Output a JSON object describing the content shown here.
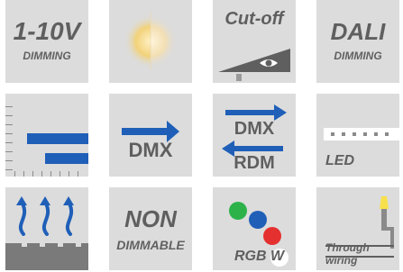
{
  "tiles": [
    {
      "id": "dimming-1-10v",
      "title": "1-10V",
      "subtitle": "DIMMING",
      "icon": "1-10v-dimming-icon"
    },
    {
      "id": "light-temperature",
      "icon": "color-temperature-icon"
    },
    {
      "id": "cut-off",
      "title": "Cut-off",
      "icon": "cut-off-eye-icon"
    },
    {
      "id": "dali-dimming",
      "title": "DALI",
      "subtitle": "DIMMING",
      "icon": "dali-dimming-icon"
    },
    {
      "id": "beam-lines",
      "icon": "linear-beam-icon"
    },
    {
      "id": "dmx",
      "label": "DMX",
      "icon": "dmx-arrow-icon"
    },
    {
      "id": "dmx-rdm",
      "label_top": "DMX",
      "label_bottom": "RDM",
      "icon": "dmx-rdm-arrows-icon"
    },
    {
      "id": "led-strip",
      "label": "LED",
      "icon": "led-strip-icon"
    },
    {
      "id": "heat-dissipation",
      "icon": "heat-dissipation-arrows-icon"
    },
    {
      "id": "non-dimmable",
      "title": "NON",
      "subtitle": "DIMMABLE",
      "icon": "non-dimmable-icon"
    },
    {
      "id": "rgbw",
      "label_rgb": "RGB",
      "label_w": "W",
      "icon": "rgbw-dots-icon"
    },
    {
      "id": "through-wiring",
      "label_top": "Through",
      "label_bottom": "wiring",
      "icon": "through-wiring-icon"
    }
  ],
  "colors": {
    "tile_bg": "#dcdcdc",
    "text": "#5f5f5f",
    "blue": "#1f5fb8",
    "red": "#e53030",
    "green": "#2db24a",
    "warm": "#f7d77b"
  }
}
